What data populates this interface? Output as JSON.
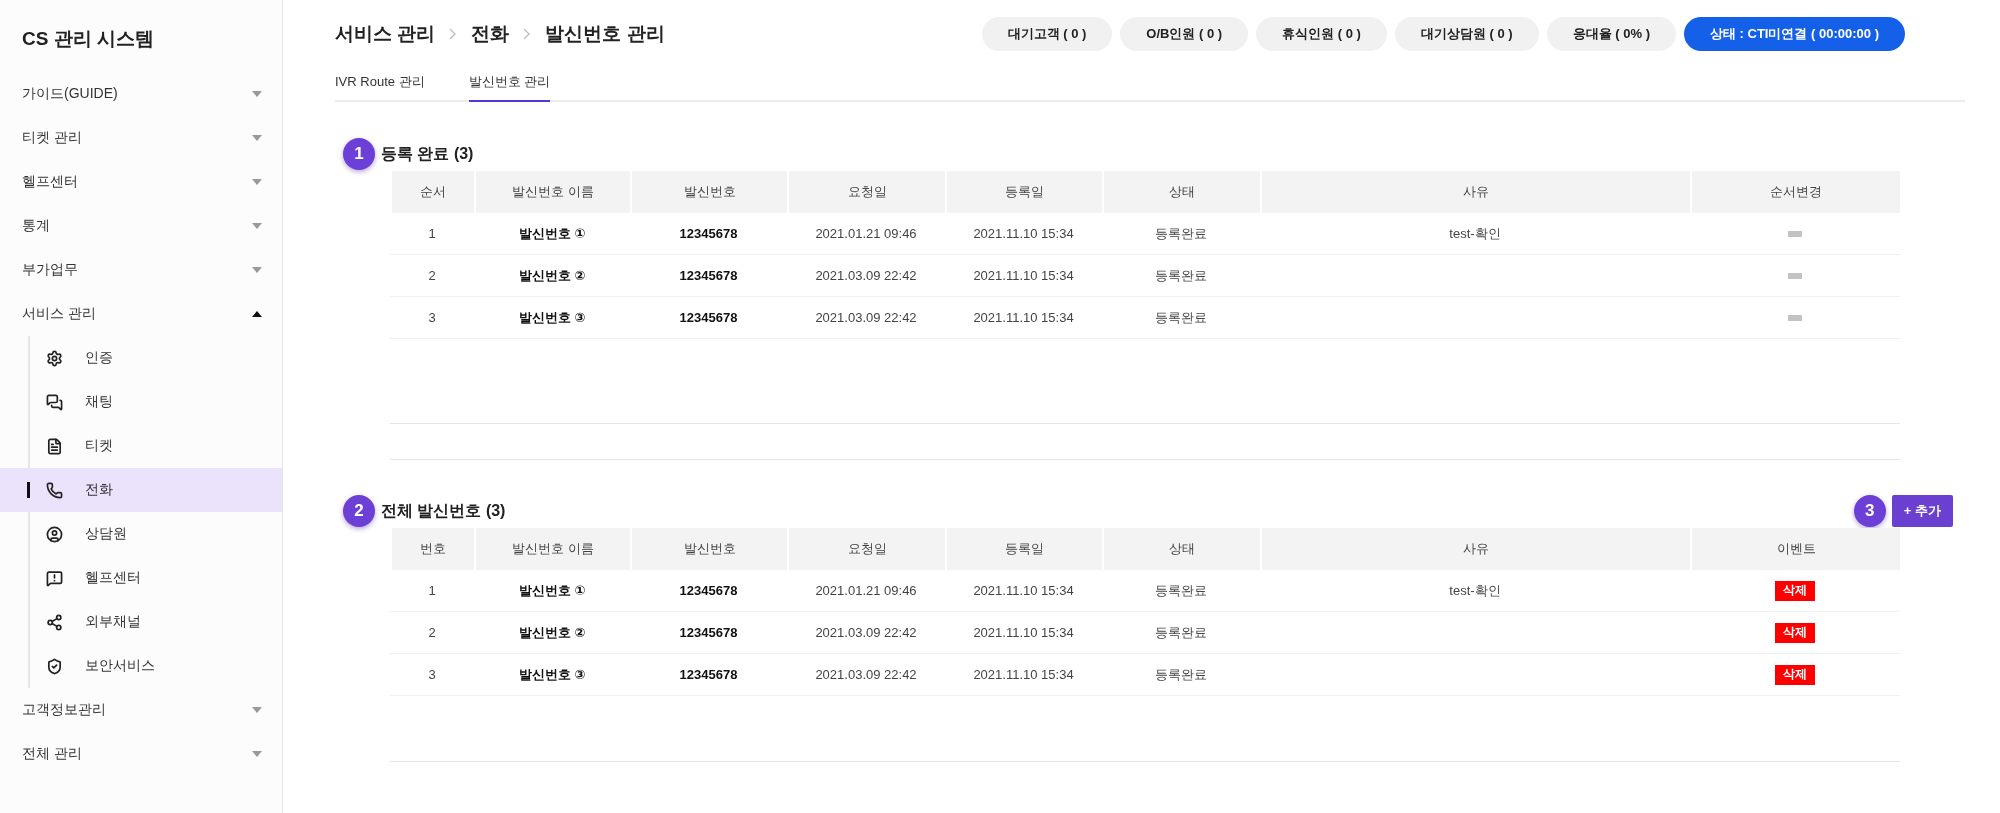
{
  "sidebar": {
    "title": "CS 관리 시스템",
    "items": [
      {
        "label": "가이드(GUIDE)",
        "expanded": false
      },
      {
        "label": "티켓 관리",
        "expanded": false
      },
      {
        "label": "헬프센터",
        "expanded": false
      },
      {
        "label": "통계",
        "expanded": false
      },
      {
        "label": "부가업무",
        "expanded": false
      },
      {
        "label": "서비스 관리",
        "expanded": true,
        "children": [
          {
            "label": "인증",
            "selected": false
          },
          {
            "label": "채팅",
            "selected": false
          },
          {
            "label": "티켓",
            "selected": false
          },
          {
            "label": "전화",
            "selected": true
          },
          {
            "label": "상담원",
            "selected": false
          },
          {
            "label": "헬프센터",
            "selected": false
          },
          {
            "label": "외부채널",
            "selected": false
          },
          {
            "label": "보안서비스",
            "selected": false
          }
        ]
      },
      {
        "label": "고객정보관리",
        "expanded": false
      },
      {
        "label": "전체 관리",
        "expanded": false
      }
    ]
  },
  "breadcrumb": [
    "서비스 관리",
    "전화",
    "발신번호 관리"
  ],
  "status_pills": [
    {
      "label": "대기고객 ( 0 )",
      "kind": "count"
    },
    {
      "label": "O/B인원 ( 0 )",
      "kind": "count"
    },
    {
      "label": "휴식인원 ( 0 )",
      "kind": "count"
    },
    {
      "label": "대기상담원 ( 0 )",
      "kind": "count"
    },
    {
      "label": "응대율 ( 0% )",
      "kind": "count"
    },
    {
      "label": "상태 : CTI미연결 ( 00:00:00 )",
      "kind": "status"
    }
  ],
  "tabs": [
    {
      "label": "IVR Route 관리",
      "selected": false
    },
    {
      "label": "발신번호 관리",
      "selected": true
    }
  ],
  "sections": [
    {
      "marker": "1",
      "title": "등록 완료 (3)",
      "columns": [
        "순서",
        "발신번호 이름",
        "발신번호",
        "요청일",
        "등록일",
        "상태",
        "사유",
        "순서변경"
      ],
      "rows": [
        {
          "kind": "reorder",
          "cells": [
            "1",
            "발신번호 ①",
            "12345678",
            "2021.01.21 09:46",
            "2021.11.10 15:34",
            "등록완료",
            "test-확인"
          ]
        },
        {
          "kind": "reorder",
          "cells": [
            "2",
            "발신번호 ②",
            "12345678",
            "2021.03.09 22:42",
            "2021.11.10 15:34",
            "등록완료",
            ""
          ]
        },
        {
          "kind": "reorder",
          "cells": [
            "3",
            "발신번호 ③",
            "12345678",
            "2021.03.09 22:42",
            "2021.11.10 15:34",
            "등록완료",
            ""
          ]
        }
      ]
    },
    {
      "marker": "2",
      "title": "전체 발신번호 (3)",
      "add_button": {
        "marker": "3",
        "label": "+ 추가"
      },
      "columns": [
        "번호",
        "발신번호 이름",
        "발신번호",
        "요청일",
        "등록일",
        "상태",
        "사유",
        "이벤트"
      ],
      "rows": [
        {
          "kind": "delete",
          "cells": [
            "1",
            "발신번호 ①",
            "12345678",
            "2021.01.21 09:46",
            "2021.11.10 15:34",
            "등록완료",
            "test-확인"
          ],
          "button": "삭제"
        },
        {
          "kind": "delete",
          "cells": [
            "2",
            "발신번호 ②",
            "12345678",
            "2021.03.09 22:42",
            "2021.11.10 15:34",
            "등록완료",
            ""
          ],
          "button": "삭제"
        },
        {
          "kind": "delete",
          "cells": [
            "3",
            "발신번호 ③",
            "12345678",
            "2021.03.09 22:42",
            "2021.11.10 15:34",
            "등록완료",
            ""
          ],
          "button": "삭제"
        }
      ]
    }
  ]
}
